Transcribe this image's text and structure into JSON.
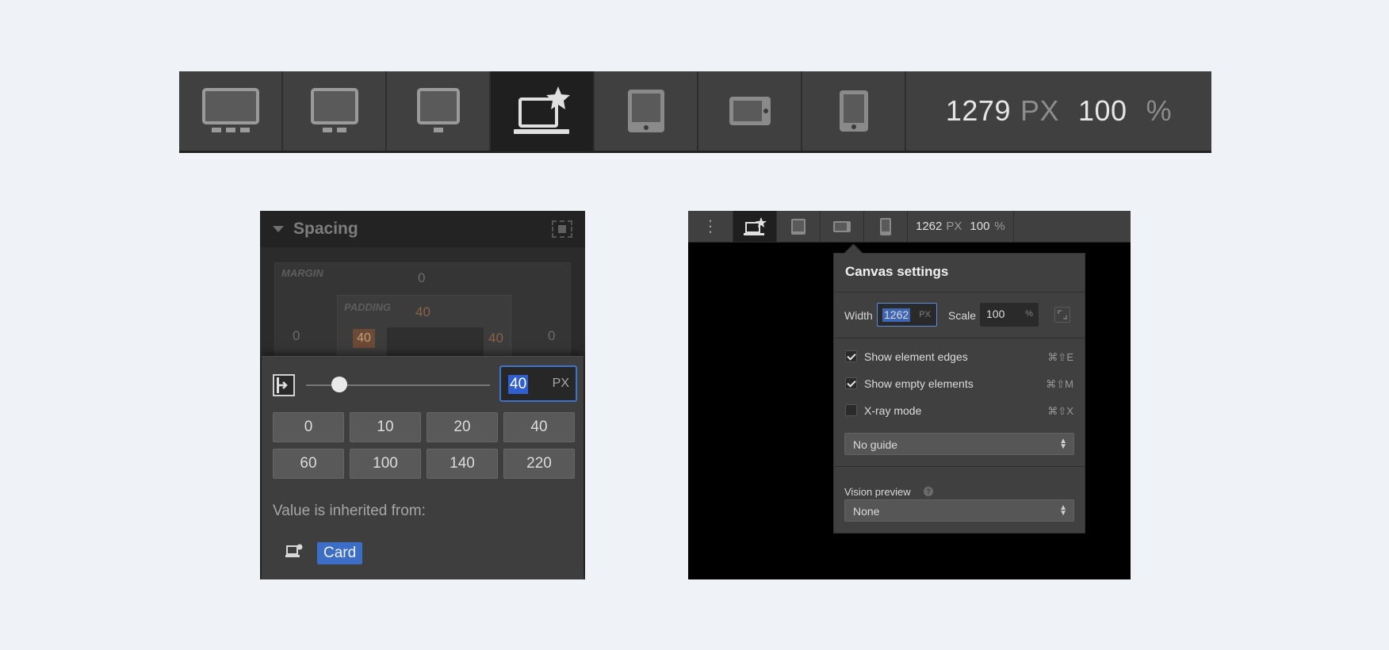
{
  "breakpoint_bar": {
    "buttons": [
      {
        "name": "desktop-xxl",
        "icon": "monitor-three-dots-icon"
      },
      {
        "name": "desktop-xl",
        "icon": "monitor-two-dots-icon"
      },
      {
        "name": "desktop-large",
        "icon": "monitor-one-dot-icon"
      },
      {
        "name": "desktop-base",
        "icon": "laptop-star-icon",
        "active": true
      },
      {
        "name": "tablet",
        "icon": "tablet-icon"
      },
      {
        "name": "mobile-landscape",
        "icon": "phone-landscape-icon"
      },
      {
        "name": "mobile-portrait",
        "icon": "phone-portrait-icon"
      }
    ],
    "width_value": "1279",
    "width_unit": "PX",
    "scale_value": "100",
    "scale_unit": "%"
  },
  "spacing_panel": {
    "title": "Spacing",
    "margin_label": "MARGIN",
    "margin": {
      "top": "0",
      "left": "0",
      "right": "0"
    },
    "padding_label": "PADDING",
    "padding": {
      "top": "40",
      "left": "40",
      "right": "40"
    },
    "popup": {
      "value": "40",
      "unit": "PX",
      "slider_fraction": 0.18,
      "presets": [
        "0",
        "10",
        "20",
        "40",
        "60",
        "100",
        "140",
        "220"
      ],
      "inherited_text": "Value is inherited from:",
      "inherited_source": "Card"
    }
  },
  "canvas_panel": {
    "toolbar": {
      "menu_glyph": "⋮",
      "width_value": "1262",
      "width_unit": "PX",
      "scale_value": "100",
      "scale_unit": "%"
    },
    "settings": {
      "title": "Canvas settings",
      "width_label": "Width",
      "width_value": "1262",
      "width_unit": "PX",
      "scale_label": "Scale",
      "scale_value": "100",
      "scale_unit": "%",
      "options": [
        {
          "label": "Show element edges",
          "shortcut": "⌘⇧E",
          "checked": true
        },
        {
          "label": "Show empty elements",
          "shortcut": "⌘⇧M",
          "checked": true
        },
        {
          "label": "X-ray mode",
          "shortcut": "⌘⇧X",
          "checked": false
        }
      ],
      "guide_select": "No guide",
      "vision_label": "Vision preview",
      "vision_select": "None"
    }
  },
  "colors": {
    "accent_blue": "#3c6dc7",
    "bar_bg": "#404040",
    "active_bg": "#1f1f1f",
    "page_bg": "#eff3f7"
  }
}
